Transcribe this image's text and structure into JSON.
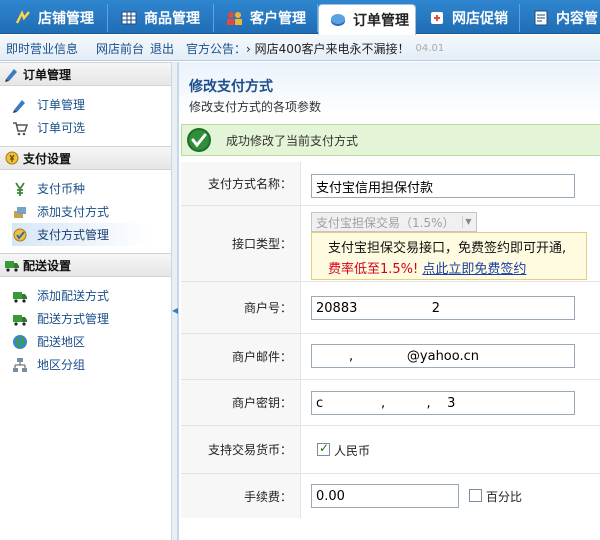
{
  "top_tabs": [
    {
      "label": "店铺管理",
      "icon": "store-icon"
    },
    {
      "label": "商品管理",
      "icon": "grid-icon"
    },
    {
      "label": "客户管理",
      "icon": "people-icon"
    },
    {
      "label": "订单管理",
      "icon": "order-icon",
      "active": true
    },
    {
      "label": "网店促销",
      "icon": "promo-icon"
    },
    {
      "label": "内容管",
      "icon": "content-icon"
    }
  ],
  "subbar": {
    "link_1": "即时营业信息",
    "link_2": "网店前台",
    "link_3": "退出",
    "notice_label": "官方公告：",
    "notice_text": "› 网店400客户来电永不漏接！",
    "notice_date": "04.01"
  },
  "sidebar": {
    "groups": [
      {
        "title": "订单管理",
        "items": [
          "订单管理",
          "订单可选"
        ]
      },
      {
        "title": "支付设置",
        "items": [
          "支付币种",
          "添加支付方式",
          "支付方式管理"
        ]
      },
      {
        "title": "配送设置",
        "items": [
          "添加配送方式",
          "配送方式管理",
          "配送地区",
          "地区分组"
        ]
      }
    ]
  },
  "page": {
    "title": "修改支付方式",
    "subtitle": "修改支付方式的各项参数",
    "success_message": "成功修改了当前支付方式"
  },
  "form": {
    "name_label": "支付方式名称：",
    "name_value": "支付宝信用担保付款",
    "interface_label": "接口类型：",
    "interface_value": "支付宝担保交易（1.5%）",
    "tip_line1": "支付宝担保交易接口，免费签约即可开通,",
    "tip_highlight": "费率低至1.5%!",
    "tip_link": "点此立即免费签约",
    "merchant_label": "商户号：",
    "merchant_value": "20883                  2",
    "email_label": "商户邮件：",
    "email_value": "        ,             @yahoo.cn",
    "key_label": "商户密钥：",
    "key_value": "c              ,          ,    3",
    "currency_label": "支持交易货币：",
    "currency_option": "人民币",
    "fee_label": "手续费：",
    "fee_value": "0.00",
    "percent_label": "百分比"
  }
}
